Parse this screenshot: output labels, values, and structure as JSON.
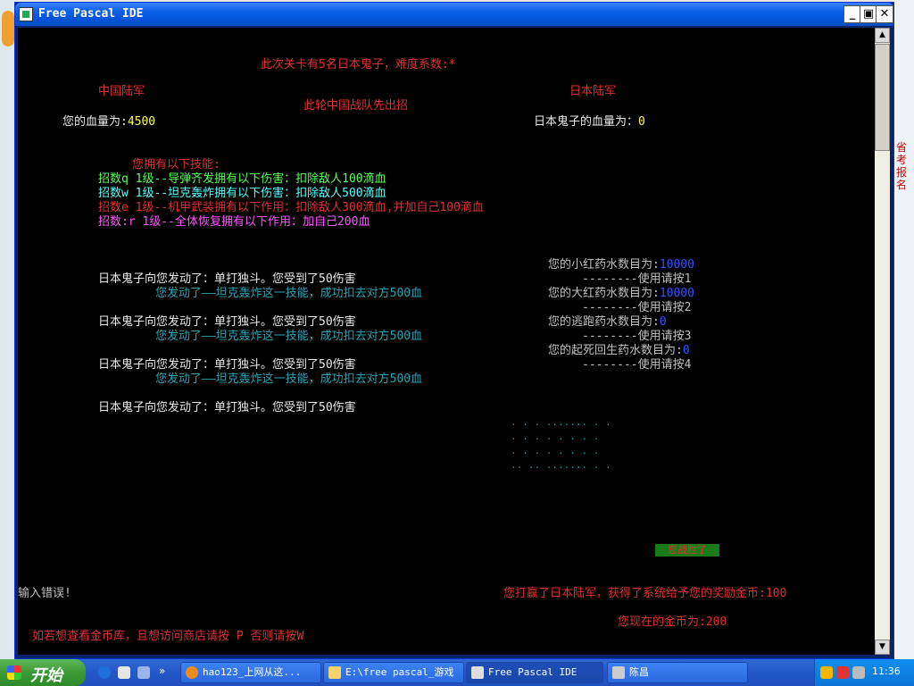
{
  "window": {
    "title": "Free Pascal IDE",
    "min_label": "_",
    "max_label": "▣",
    "close_label": "✕"
  },
  "console": {
    "level_info": "此次关卡有5名日本鬼子，难度系数:*",
    "china_army": "中国陆军",
    "japan_army": "日本陆军",
    "first_move": "此轮中国战队先出招",
    "your_hp_label": "您的血量为:",
    "your_hp_value": "4500",
    "enemy_hp_label": "日本鬼子的血量为：",
    "enemy_hp_value": "0",
    "skills_header": "您拥有以下技能:",
    "skill_q": "招数q 1级--导弹齐发拥有以下伤害：扣除敌人100滴血",
    "skill_w": "招数w 1级--坦克轰炸拥有以下伤害：扣除敌人500滴血",
    "skill_e": "招数e 1级--机甲武装拥有以下作用：扣除敌人300滴血,并加自己100滴血",
    "skill_r": "招数:r 1级--全体恢复拥有以下作用：加自己200血",
    "battle_log": [
      {
        "enemy": "日本鬼子向您发动了：单打独斗。您受到了50伤害",
        "you": "您发动了——坦克轰炸这一技能，成功扣去对方500血"
      },
      {
        "enemy": "日本鬼子向您发动了：单打独斗。您受到了50伤害",
        "you": "您发动了——坦克轰炸这一技能，成功扣去对方500血"
      },
      {
        "enemy": "日本鬼子向您发动了：单打独斗。您受到了50伤害",
        "you": "您发动了——坦克轰炸这一技能，成功扣去对方500血"
      },
      {
        "enemy": "日本鬼子向您发动了：单打独斗。您受到了50伤害",
        "you": ""
      }
    ],
    "potions": [
      {
        "label": "您的小红药水数目为:",
        "value": "10000",
        "hint": "--------使用请按1"
      },
      {
        "label": "您的大红药水数目为:",
        "value": "10000",
        "hint": "--------使用请按2"
      },
      {
        "label": "您的逃跑药水数目为:",
        "value": "0",
        "hint": "--------使用请按3"
      },
      {
        "label": "您的起死回生药水数目为:",
        "value": "0",
        "hint": "--------使用请按4"
      }
    ],
    "ascii_art": [
      ".    .     .  .......    .    .",
      " .  . .   .      .       . .  .",
      "  . .  . .       .       .   . .",
      "  ..    ..    .......    .    ."
    ],
    "bar_text": "您战胜了",
    "input_error": "输入错误!",
    "victory_msg": "您打赢了日本陆军，获得了系统给予您的奖励金币:100",
    "gold_msg": "您现在的金币为:200",
    "shop_prompt": "如若想查看金币库，且想访问商店请按 P 否则请按W"
  },
  "desktop": {
    "right_edge_text": "省考\n报名"
  },
  "taskbar": {
    "start_label": "开始",
    "more_label": "»",
    "tasks": [
      {
        "label": "hao123_上网从这...",
        "icon_color": "#f08a20"
      },
      {
        "label": "E:\\free pascal_游戏",
        "icon_color": "#f3d36a"
      },
      {
        "label": "Free Pascal IDE",
        "icon_color": "#dddddd"
      },
      {
        "label": "陈昌",
        "icon_color": "#cccccc"
      }
    ],
    "clock": "11:36"
  }
}
